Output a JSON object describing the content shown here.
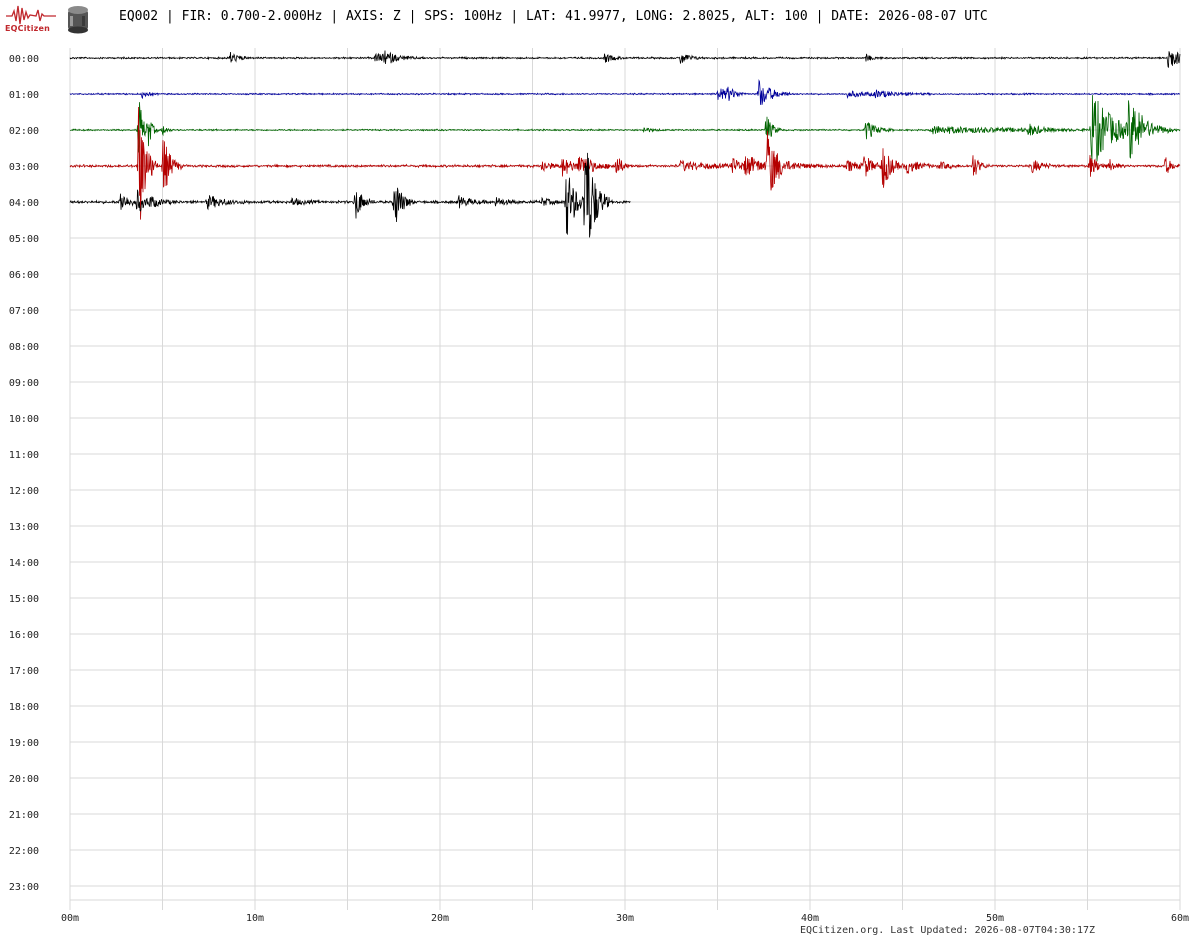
{
  "header": {
    "logo_text": "EQCitizen",
    "title": "EQ002 | FIR: 0.700-2.000Hz | AXIS: Z | SPS: 100Hz | LAT: 41.9977, LONG: 2.8025, ALT: 100 | DATE: 2026-08-07 UTC"
  },
  "footer": {
    "text": "EQCitizen.org. Last Updated: 2026-08-07T04:30:17Z"
  },
  "chart_data": {
    "type": "line",
    "subtype": "helicorder",
    "title": "EQ002 | FIR: 0.700-2.000Hz | AXIS: Z | SPS: 100Hz | LAT: 41.9977, LONG: 2.8025, ALT: 100 | DATE: 2026-08-07 UTC",
    "hour_labels": [
      "00:00",
      "01:00",
      "02:00",
      "03:00",
      "04:00",
      "05:00",
      "06:00",
      "07:00",
      "08:00",
      "09:00",
      "10:00",
      "11:00",
      "12:00",
      "13:00",
      "14:00",
      "15:00",
      "16:00",
      "17:00",
      "18:00",
      "19:00",
      "20:00",
      "21:00",
      "22:00",
      "23:00"
    ],
    "minute_ticks": [
      0,
      10,
      20,
      30,
      40,
      50,
      60
    ],
    "minute_labels": [
      "00m",
      "10m",
      "20m",
      "30m",
      "40m",
      "50m",
      "60m"
    ],
    "xlim": [
      0,
      60
    ],
    "ylim_hours": [
      0,
      23
    ],
    "grid": true,
    "trace_colors": [
      "#000000",
      "#00009b",
      "#006400",
      "#b40000"
    ],
    "traces": [
      {
        "hour": "00:00",
        "color": "#000000",
        "end_minute": 60,
        "noise": 0.7,
        "events": [
          {
            "t": 8.6,
            "amp": 7,
            "dur": 0.4
          },
          {
            "t": 16.5,
            "amp": 5,
            "dur": 0.9
          },
          {
            "t": 17.0,
            "amp": 5,
            "dur": 0.5
          },
          {
            "t": 28.9,
            "amp": 5,
            "dur": 0.4
          },
          {
            "t": 33.0,
            "amp": 7,
            "dur": 0.4
          },
          {
            "t": 43.0,
            "amp": 4,
            "dur": 0.3
          },
          {
            "t": 59.3,
            "amp": 14,
            "dur": 0.6
          }
        ]
      },
      {
        "hour": "01:00",
        "color": "#00009b",
        "end_minute": 60,
        "noise": 0.6,
        "events": [
          {
            "t": 3.9,
            "amp": 4,
            "dur": 0.3
          },
          {
            "t": 35.0,
            "amp": 8,
            "dur": 0.5
          },
          {
            "t": 35.5,
            "amp": 6,
            "dur": 0.4
          },
          {
            "t": 37.2,
            "amp": 16,
            "dur": 0.6
          },
          {
            "t": 42.0,
            "amp": 3,
            "dur": 1.5
          },
          {
            "t": 43.5,
            "amp": 3,
            "dur": 1.0
          }
        ]
      },
      {
        "hour": "02:00",
        "color": "#006400",
        "end_minute": 60,
        "noise": 0.6,
        "events": [
          {
            "t": 3.7,
            "amp": 40,
            "dur": 0.2
          },
          {
            "t": 4.2,
            "amp": 20,
            "dur": 0.2
          },
          {
            "t": 5.0,
            "amp": 6,
            "dur": 0.2
          },
          {
            "t": 31.0,
            "amp": 3,
            "dur": 0.4
          },
          {
            "t": 37.6,
            "amp": 18,
            "dur": 0.3
          },
          {
            "t": 43.0,
            "amp": 11,
            "dur": 0.5
          },
          {
            "t": 46.5,
            "amp": 4,
            "dur": 4.5
          },
          {
            "t": 51.8,
            "amp": 6,
            "dur": 0.5
          },
          {
            "t": 55.2,
            "amp": 42,
            "dur": 1.0
          },
          {
            "t": 57.2,
            "amp": 30,
            "dur": 0.8
          }
        ]
      },
      {
        "hour": "03:00",
        "color": "#b40000",
        "end_minute": 60,
        "noise": 1.0,
        "events": [
          {
            "t": 3.7,
            "amp": 75,
            "dur": 0.35
          },
          {
            "t": 5.0,
            "amp": 36,
            "dur": 0.35
          },
          {
            "t": 25.5,
            "amp": 7,
            "dur": 0.4
          },
          {
            "t": 26.6,
            "amp": 10,
            "dur": 0.6
          },
          {
            "t": 27.5,
            "amp": 10,
            "dur": 0.8
          },
          {
            "t": 29.5,
            "amp": 12,
            "dur": 0.3
          },
          {
            "t": 33.0,
            "amp": 5,
            "dur": 1.5
          },
          {
            "t": 35.8,
            "amp": 7,
            "dur": 0.6
          },
          {
            "t": 36.5,
            "amp": 9,
            "dur": 1.0
          },
          {
            "t": 37.7,
            "amp": 45,
            "dur": 0.3
          },
          {
            "t": 38.0,
            "amp": 6,
            "dur": 1.2
          },
          {
            "t": 42.0,
            "amp": 6,
            "dur": 0.6
          },
          {
            "t": 42.9,
            "amp": 12,
            "dur": 0.4
          },
          {
            "t": 43.9,
            "amp": 26,
            "dur": 0.4
          },
          {
            "t": 45.2,
            "amp": 8,
            "dur": 0.6
          },
          {
            "t": 47.0,
            "amp": 4,
            "dur": 0.5
          },
          {
            "t": 48.8,
            "amp": 14,
            "dur": 0.3
          },
          {
            "t": 52.0,
            "amp": 7,
            "dur": 0.5
          },
          {
            "t": 55.1,
            "amp": 12,
            "dur": 0.4
          },
          {
            "t": 56.2,
            "amp": 6,
            "dur": 0.3
          },
          {
            "t": 59.2,
            "amp": 10,
            "dur": 0.3
          }
        ]
      },
      {
        "hour": "04:00",
        "color": "#000000",
        "end_minute": 30.3,
        "noise": 1.1,
        "events": [
          {
            "t": 2.7,
            "amp": 12,
            "dur": 0.4
          },
          {
            "t": 3.6,
            "amp": 12,
            "dur": 0.4
          },
          {
            "t": 4.3,
            "amp": 5,
            "dur": 0.6
          },
          {
            "t": 7.4,
            "amp": 7,
            "dur": 0.8
          },
          {
            "t": 12.0,
            "amp": 4,
            "dur": 0.5
          },
          {
            "t": 15.4,
            "amp": 20,
            "dur": 0.35
          },
          {
            "t": 17.5,
            "amp": 32,
            "dur": 0.35
          },
          {
            "t": 21.0,
            "amp": 6,
            "dur": 0.6
          },
          {
            "t": 23.0,
            "amp": 5,
            "dur": 0.5
          },
          {
            "t": 25.5,
            "amp": 4,
            "dur": 0.5
          },
          {
            "t": 26.8,
            "amp": 40,
            "dur": 0.45
          },
          {
            "t": 27.8,
            "amp": 80,
            "dur": 0.45
          }
        ]
      }
    ]
  }
}
